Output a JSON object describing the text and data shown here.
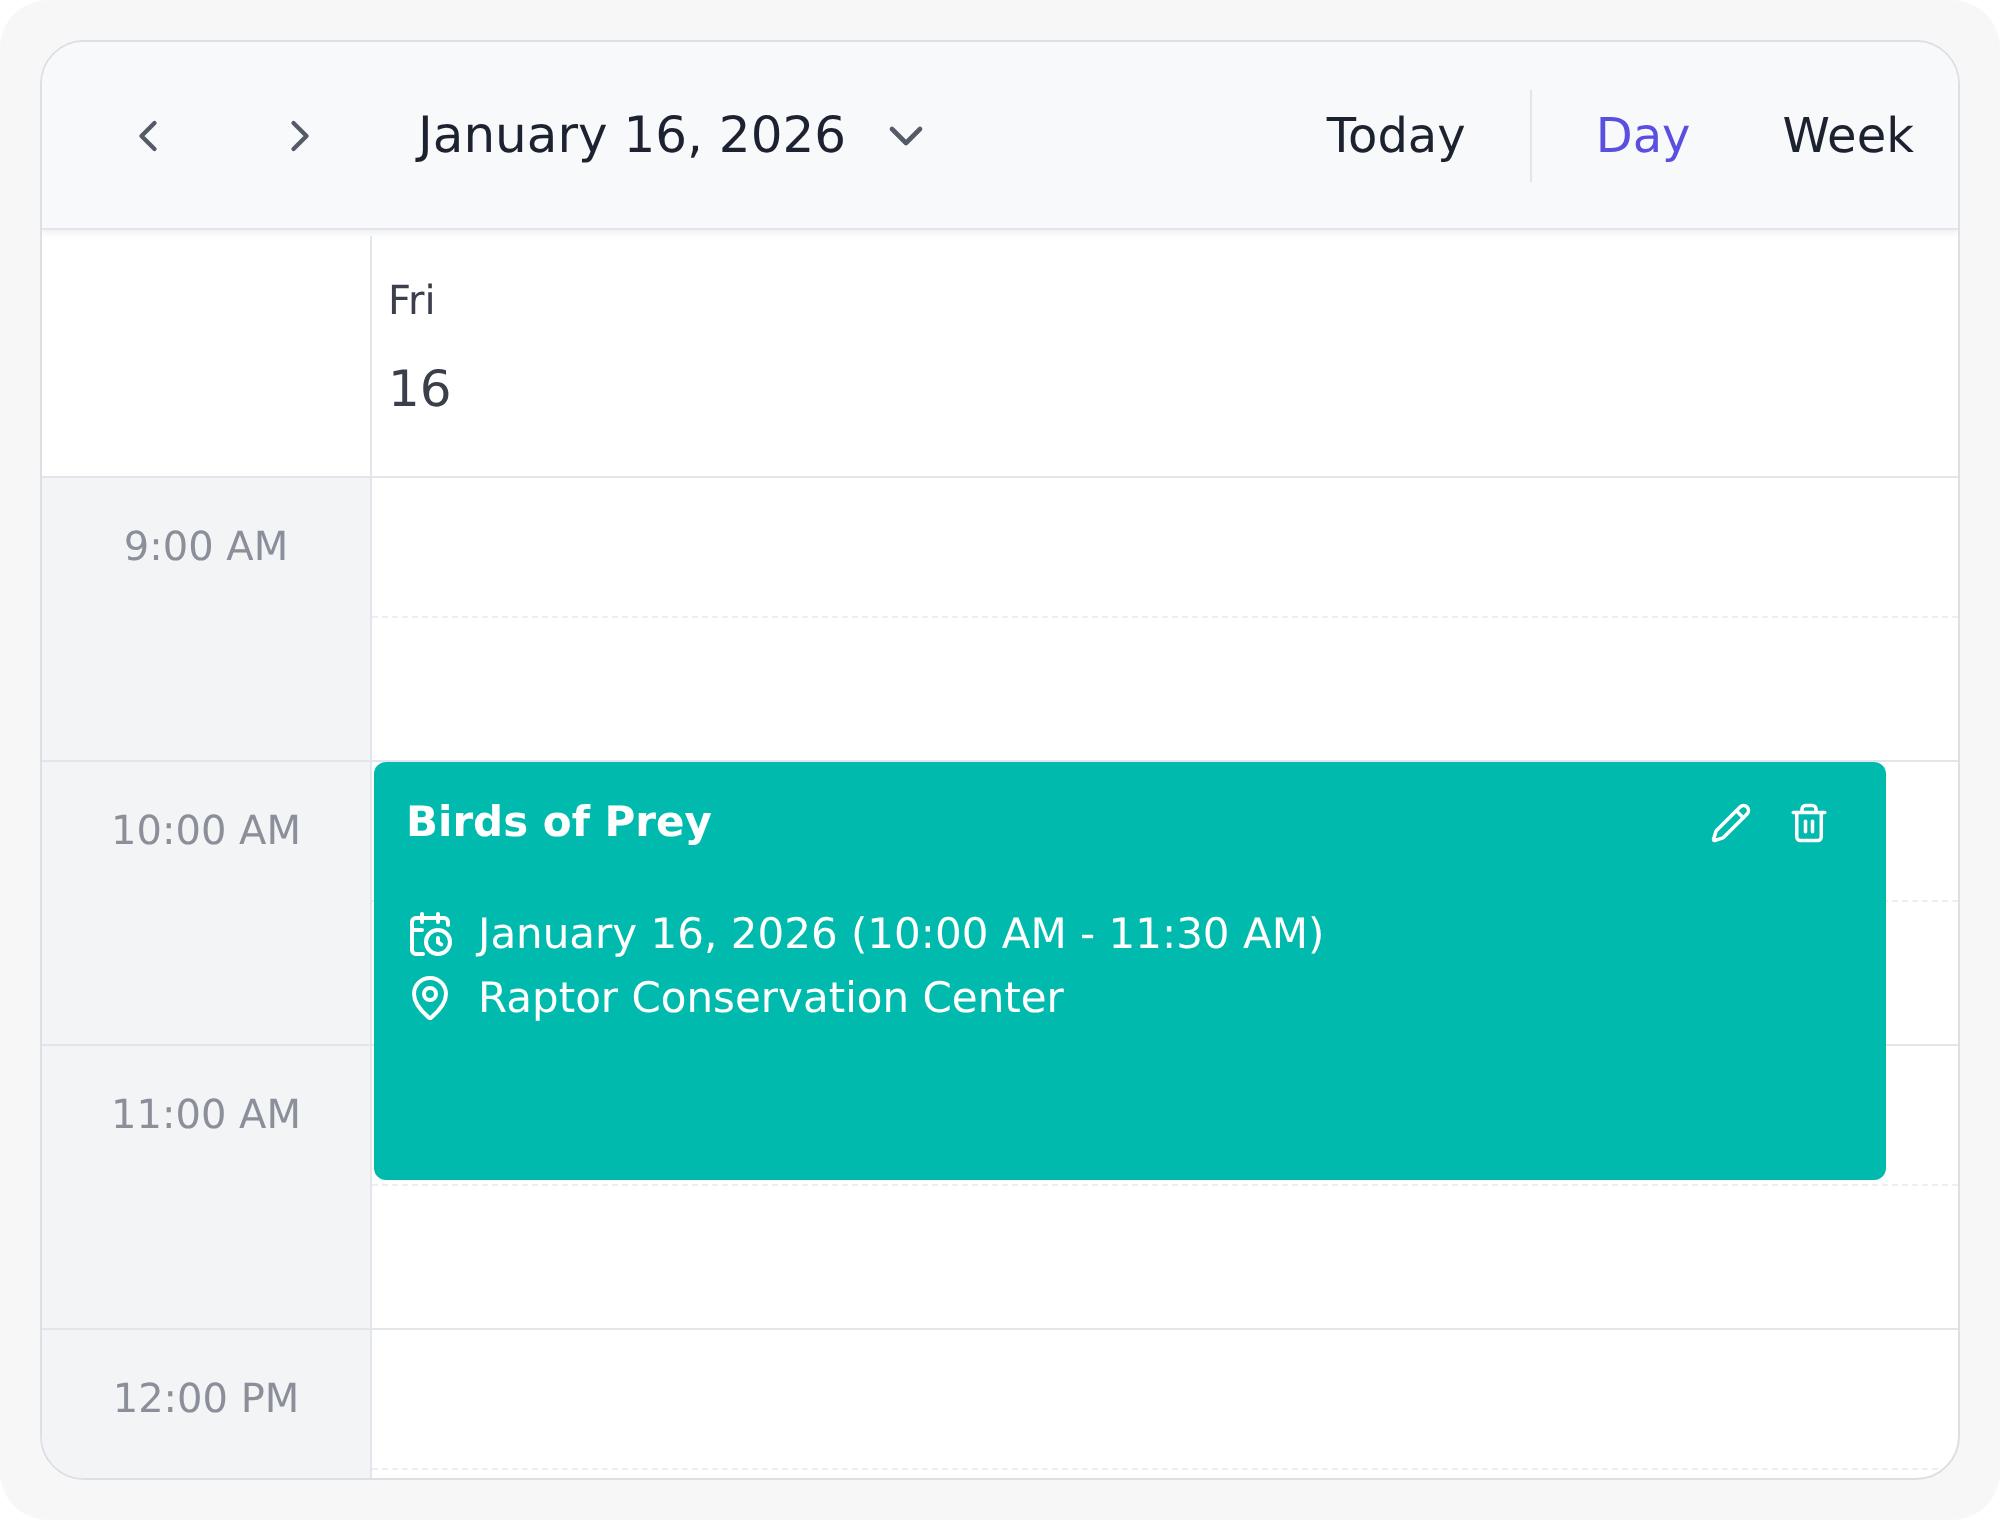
{
  "toolbar": {
    "date": "January 16, 2026",
    "today": "Today",
    "views": [
      {
        "label": "Day",
        "selected": true
      },
      {
        "label": "Week",
        "selected": false
      }
    ]
  },
  "day_header": {
    "weekday": "Fri",
    "day": "16"
  },
  "hours": [
    "9:00 AM",
    "10:00 AM",
    "11:00 AM",
    "12:00 PM"
  ],
  "event": {
    "title": "Birds of Prey",
    "when": "January 16, 2026 (10:00 AM - 11:30 AM)",
    "location": "Raptor Conservation Center",
    "color": "#00bbad"
  }
}
